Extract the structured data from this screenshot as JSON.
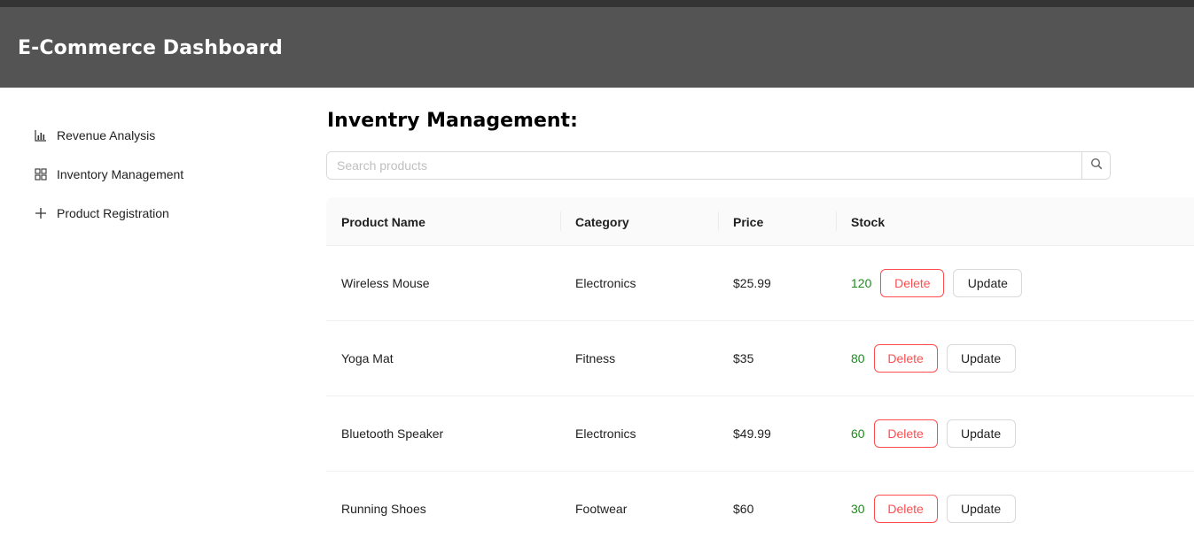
{
  "header": {
    "title": "E-Commerce Dashboard"
  },
  "sidebar": {
    "items": [
      {
        "label": "Revenue Analysis",
        "icon": "bar-chart-icon"
      },
      {
        "label": "Inventory Management",
        "icon": "grid-icon"
      },
      {
        "label": "Product Registration",
        "icon": "plus-icon"
      }
    ]
  },
  "main": {
    "title": "Inventry Management:",
    "search": {
      "placeholder": "Search products",
      "value": ""
    },
    "table": {
      "columns": [
        "Product Name",
        "Category",
        "Price",
        "Stock"
      ],
      "rows": [
        {
          "name": "Wireless Mouse",
          "category": "Electronics",
          "price": "$25.99",
          "stock": "120",
          "delete_label": "Delete",
          "update_label": "Update"
        },
        {
          "name": "Yoga Mat",
          "category": "Fitness",
          "price": "$35",
          "stock": "80",
          "delete_label": "Delete",
          "update_label": "Update"
        },
        {
          "name": "Bluetooth Speaker",
          "category": "Electronics",
          "price": "$49.99",
          "stock": "60",
          "delete_label": "Delete",
          "update_label": "Update"
        },
        {
          "name": "Running Shoes",
          "category": "Footwear",
          "price": "$60",
          "stock": "30",
          "delete_label": "Delete",
          "update_label": "Update"
        }
      ]
    }
  },
  "colors": {
    "header_bg": "#545454",
    "stock_text": "#1f8a1f",
    "delete_accent": "#ff4d4f"
  }
}
